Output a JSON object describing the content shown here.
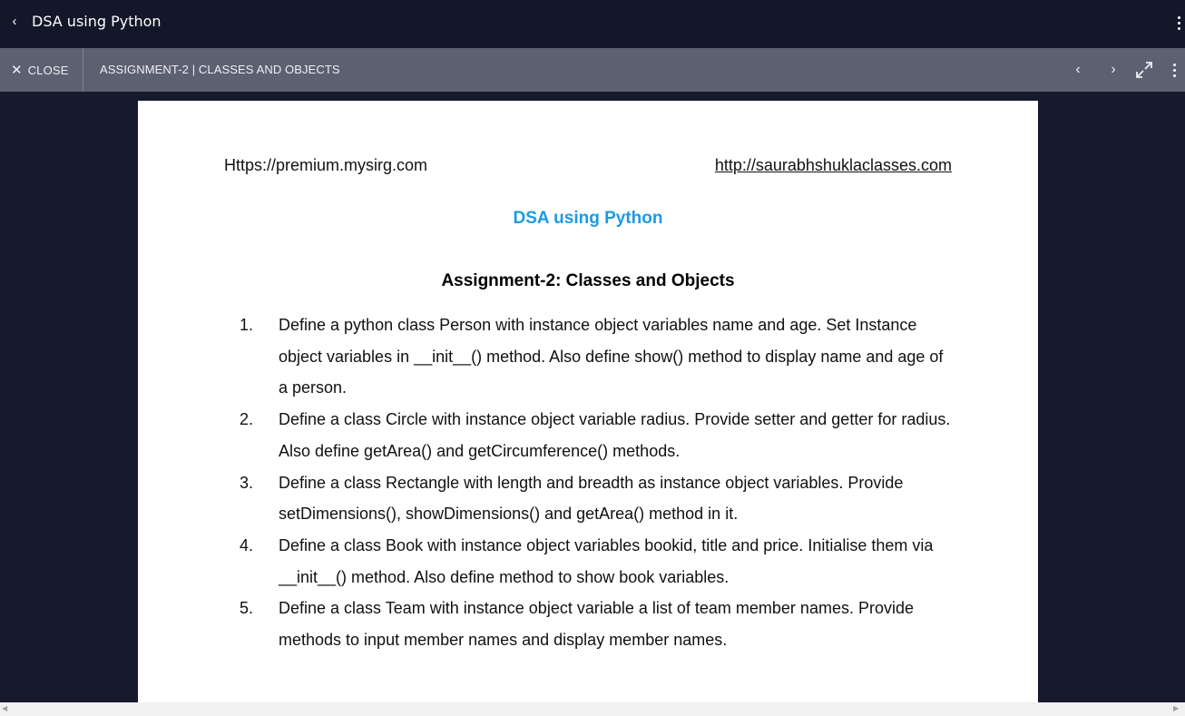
{
  "topbar": {
    "back_icon": "chevron-left-icon",
    "title": "DSA using Python",
    "menu_icon": "more-vertical-icon"
  },
  "toolbar": {
    "close_label": "CLOSE",
    "close_icon": "close-icon",
    "document_title": "ASSIGNMENT-2 | CLASSES AND OBJECTS",
    "prev_icon": "chevron-left-icon",
    "next_icon": "chevron-right-icon",
    "expand_icon": "expand-icon",
    "menu_icon": "more-vertical-icon"
  },
  "document": {
    "header_left": "Https://premium.mysirg.com",
    "header_right": "http://saurabhshuklaclasses.com",
    "heading": "DSA using Python",
    "heading_color": "#1a9be6",
    "subheading": "Assignment-2: Classes and Objects",
    "tasks": [
      {
        "num": "1.",
        "text": "Define a python class Person with instance object variables name and age. Set Instance object variables in __init__() method. Also define show() method to display name and age of a person."
      },
      {
        "num": "2.",
        "text": "Define a class Circle with instance object variable radius. Provide setter and getter for radius. Also define getArea() and getCircumference() methods."
      },
      {
        "num": "3.",
        "text": "Define a class Rectangle with length and breadth as instance object variables. Provide setDimensions(), showDimensions() and getArea() method in it."
      },
      {
        "num": "4.",
        "text": "Define a class Book with instance object variables bookid, title and price. Initialise them via __init__() method. Also define method to show book variables."
      },
      {
        "num": "5.",
        "text": "Define a class Team with instance object variable a list of team member names. Provide methods to input member names and display member names."
      }
    ]
  }
}
